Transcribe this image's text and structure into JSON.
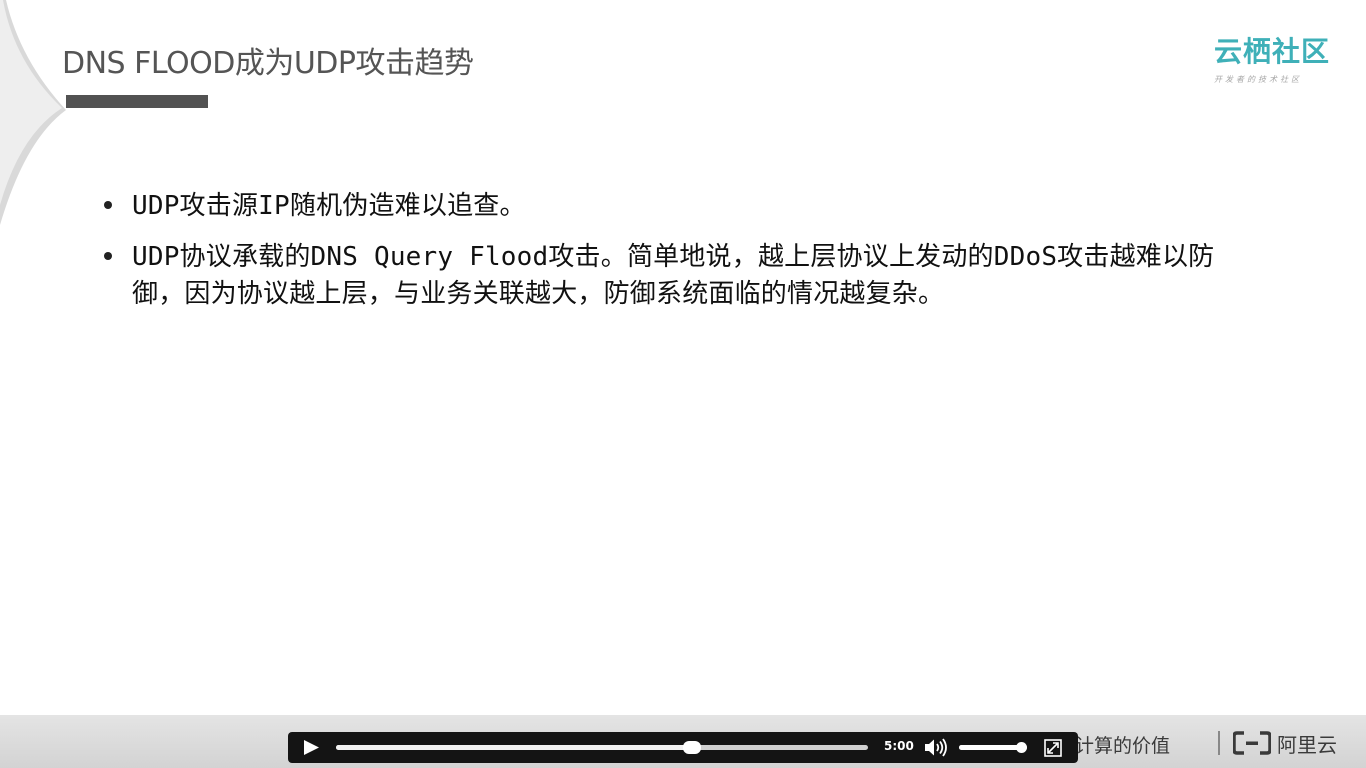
{
  "slide": {
    "title": "DNS FLOOD成为UDP攻击趋势",
    "bullets": [
      "UDP攻击源IP随机伪造难以追查。",
      "UDP协议承载的DNS Query Flood攻击。简单地说，越上层协议上发动的DDoS攻击越难以防御，因为协议越上层，与业务关联越大，防御系统面临的情况越复杂。"
    ]
  },
  "brand": {
    "name": "云栖社区",
    "slogan": "开发者的技术社区",
    "color": "#3fb0b8"
  },
  "footer": {
    "slogan": "为无法计算的价值",
    "logo_text": "阿里云"
  },
  "player": {
    "time": "5:00",
    "progress": 0.67,
    "volume": 0.93,
    "icons": {
      "play": "play-icon",
      "volume": "speaker-volume-icon",
      "fullscreen": "fullscreen-icon"
    }
  }
}
